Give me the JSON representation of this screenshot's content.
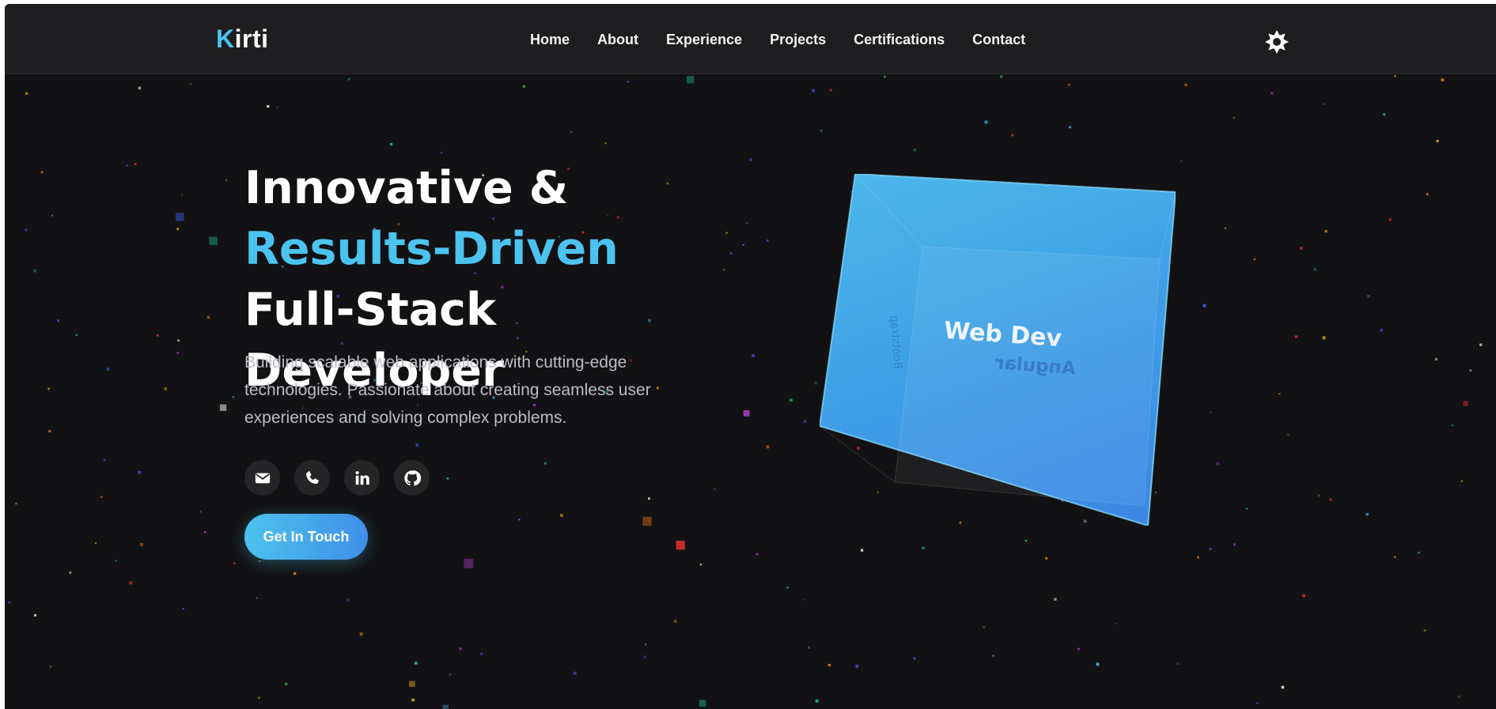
{
  "nav": {
    "logo_first": "K",
    "logo_rest": "irti",
    "links": [
      "Home",
      "About",
      "Experience",
      "Projects",
      "Certifications",
      "Contact"
    ]
  },
  "hero": {
    "title_line1": "Innovative &",
    "title_accent": "Results-Driven",
    "title_rest": " Full-Stack Developer",
    "description": "Building scalable web applications with cutting-edge technologies. Passionate about creating seamless user experiences and solving complex problems.",
    "cta_label": "Get In Touch",
    "socials": [
      {
        "icon": "mail-icon"
      },
      {
        "icon": "phone-icon"
      },
      {
        "icon": "linkedin-icon"
      },
      {
        "icon": "github-icon"
      }
    ]
  },
  "cube": {
    "front_label": "Web Dev",
    "back_label": "Angular",
    "side_label": "Bootstrap"
  },
  "colors": {
    "accent": "#4cc3ee",
    "background": "#121214",
    "navbar": "#1e1e20"
  }
}
